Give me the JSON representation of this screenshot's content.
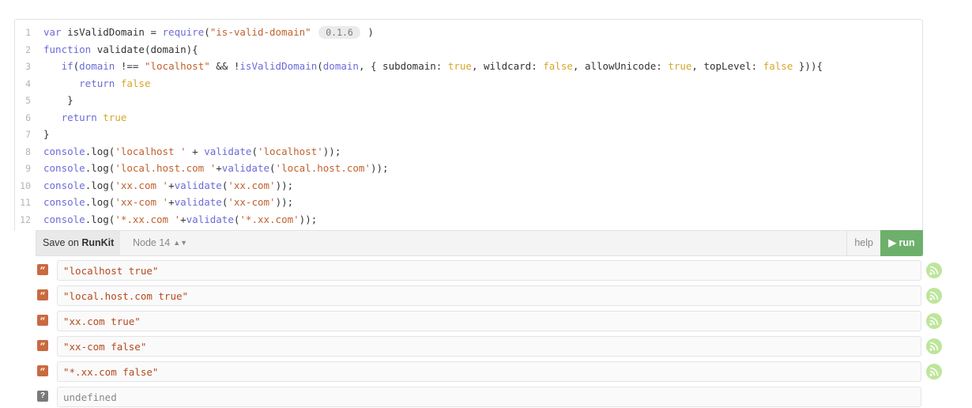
{
  "code": {
    "lines": [
      {
        "num": "1",
        "parts": [
          [
            "kw",
            "var "
          ],
          [
            "plain",
            "isValidDomain = "
          ],
          [
            "fn",
            "require"
          ],
          [
            "plain",
            "("
          ],
          [
            "str",
            "\"is-valid-domain\""
          ]
        ],
        "version": "0.1.6",
        "tail": ")"
      },
      {
        "num": "2",
        "parts": [
          [
            "kw",
            "function "
          ],
          [
            "plain",
            "validate(domain){"
          ]
        ]
      },
      {
        "num": "3",
        "parts": [
          [
            "plain",
            "   "
          ],
          [
            "kw",
            "if"
          ],
          [
            "plain",
            "("
          ],
          [
            "kw",
            "domain"
          ],
          [
            "plain",
            " !== "
          ],
          [
            "str",
            "\"localhost\""
          ],
          [
            "plain",
            " && !"
          ],
          [
            "fn",
            "isValidDomain"
          ],
          [
            "plain",
            "("
          ],
          [
            "kw",
            "domain"
          ],
          [
            "plain",
            ", { subdomain: "
          ],
          [
            "lit",
            "true"
          ],
          [
            "plain",
            ", wildcard: "
          ],
          [
            "lit",
            "false"
          ],
          [
            "plain",
            ", allowUnicode: "
          ],
          [
            "lit",
            "true"
          ],
          [
            "plain",
            ", topLevel: "
          ],
          [
            "lit",
            "false"
          ],
          [
            "plain",
            " })){"
          ]
        ]
      },
      {
        "num": "4",
        "parts": [
          [
            "plain",
            "      "
          ],
          [
            "kw",
            "return "
          ],
          [
            "lit",
            "false"
          ]
        ]
      },
      {
        "num": "5",
        "parts": [
          [
            "plain",
            "    }"
          ]
        ]
      },
      {
        "num": "6",
        "parts": [
          [
            "plain",
            "   "
          ],
          [
            "kw",
            "return "
          ],
          [
            "lit",
            "true"
          ]
        ]
      },
      {
        "num": "7",
        "parts": [
          [
            "plain",
            "}"
          ]
        ]
      },
      {
        "num": "8",
        "parts": [
          [
            "kw",
            "console"
          ],
          [
            "plain",
            ".log("
          ],
          [
            "str",
            "'localhost '"
          ],
          [
            "plain",
            " + "
          ],
          [
            "fn",
            "validate"
          ],
          [
            "plain",
            "("
          ],
          [
            "str",
            "'localhost'"
          ],
          [
            "plain",
            "));"
          ]
        ]
      },
      {
        "num": "9",
        "parts": [
          [
            "kw",
            "console"
          ],
          [
            "plain",
            ".log("
          ],
          [
            "str",
            "'local.host.com '"
          ],
          [
            "plain",
            "+"
          ],
          [
            "fn",
            "validate"
          ],
          [
            "plain",
            "("
          ],
          [
            "str",
            "'local.host.com'"
          ],
          [
            "plain",
            "));"
          ]
        ]
      },
      {
        "num": "10",
        "parts": [
          [
            "kw",
            "console"
          ],
          [
            "plain",
            ".log("
          ],
          [
            "str",
            "'xx.com '"
          ],
          [
            "plain",
            "+"
          ],
          [
            "fn",
            "validate"
          ],
          [
            "plain",
            "("
          ],
          [
            "str",
            "'xx.com'"
          ],
          [
            "plain",
            "));"
          ]
        ]
      },
      {
        "num": "11",
        "parts": [
          [
            "kw",
            "console"
          ],
          [
            "plain",
            ".log("
          ],
          [
            "str",
            "'xx-com '"
          ],
          [
            "plain",
            "+"
          ],
          [
            "fn",
            "validate"
          ],
          [
            "plain",
            "("
          ],
          [
            "str",
            "'xx-com'"
          ],
          [
            "plain",
            "));"
          ]
        ]
      },
      {
        "num": "12",
        "parts": [
          [
            "kw",
            "console"
          ],
          [
            "plain",
            ".log("
          ],
          [
            "str",
            "'*.xx.com '"
          ],
          [
            "plain",
            "+"
          ],
          [
            "fn",
            "validate"
          ],
          [
            "plain",
            "("
          ],
          [
            "str",
            "'*.xx.com'"
          ],
          [
            "plain",
            "));"
          ]
        ]
      }
    ]
  },
  "toolbar": {
    "save_prefix": "Save on ",
    "save_brand": "RunKit",
    "node_version": "Node 14",
    "node_arrows": "▲▼",
    "help_label": "help",
    "run_label": "▶ run"
  },
  "outputs": [
    {
      "type": "string",
      "icon": "quote-icon",
      "text": "\"localhost true\""
    },
    {
      "type": "string",
      "icon": "quote-icon",
      "text": "\"local.host.com true\""
    },
    {
      "type": "string",
      "icon": "quote-icon",
      "text": "\"xx.com true\""
    },
    {
      "type": "string",
      "icon": "quote-icon",
      "text": "\"xx-com false\""
    },
    {
      "type": "string",
      "icon": "quote-icon",
      "text": "\"*.xx.com false\""
    },
    {
      "type": "undefined",
      "icon": "question-icon",
      "text": "undefined"
    }
  ],
  "icons": {
    "quote_glyph": "“",
    "question_glyph": "?"
  },
  "colors": {
    "accent_run": "#6db06b",
    "string_badge": "#c96a3f",
    "rss": "#bde69b"
  }
}
